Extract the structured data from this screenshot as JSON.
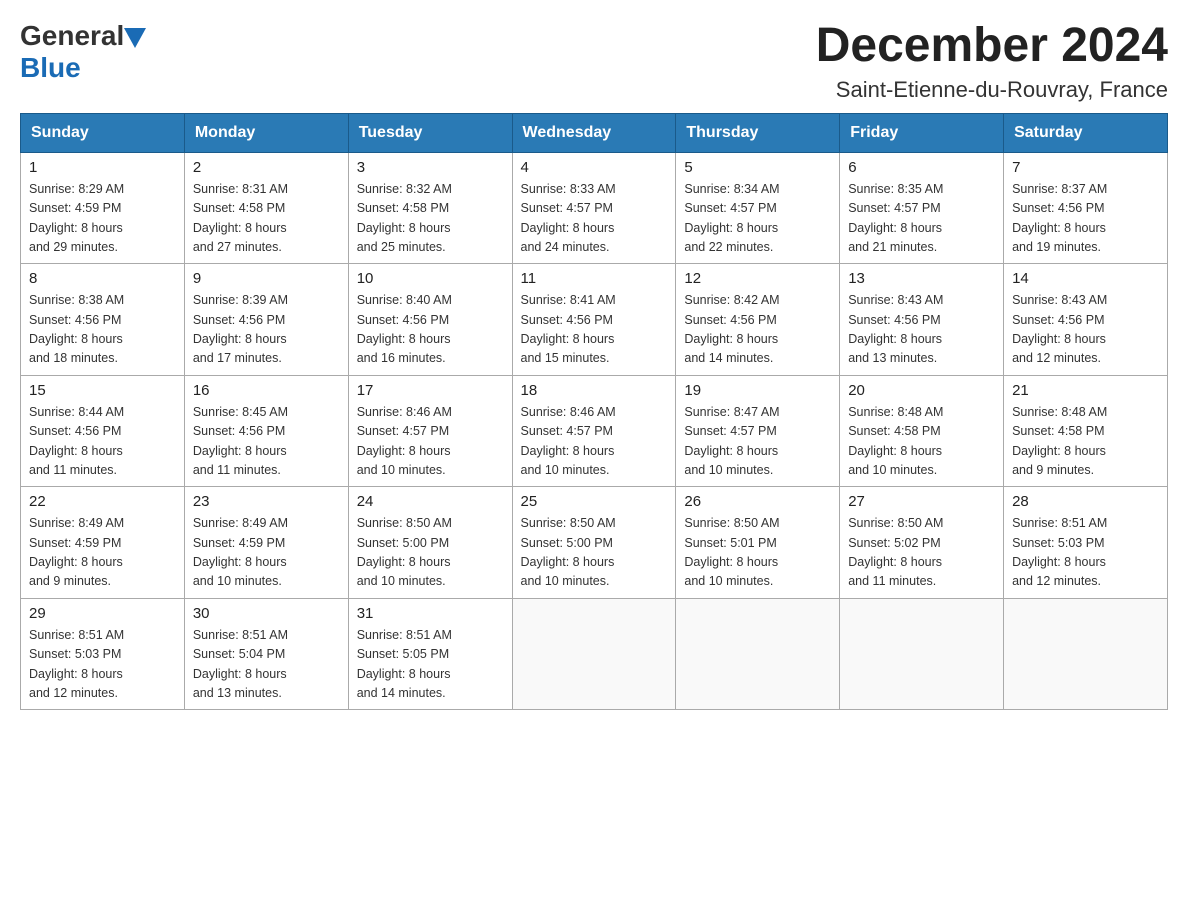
{
  "header": {
    "logo_general": "General",
    "logo_blue": "Blue",
    "month_title": "December 2024",
    "location": "Saint-Etienne-du-Rouvray, France"
  },
  "days_of_week": [
    "Sunday",
    "Monday",
    "Tuesday",
    "Wednesday",
    "Thursday",
    "Friday",
    "Saturday"
  ],
  "weeks": [
    [
      {
        "day": "1",
        "info": "Sunrise: 8:29 AM\nSunset: 4:59 PM\nDaylight: 8 hours\nand 29 minutes."
      },
      {
        "day": "2",
        "info": "Sunrise: 8:31 AM\nSunset: 4:58 PM\nDaylight: 8 hours\nand 27 minutes."
      },
      {
        "day": "3",
        "info": "Sunrise: 8:32 AM\nSunset: 4:58 PM\nDaylight: 8 hours\nand 25 minutes."
      },
      {
        "day": "4",
        "info": "Sunrise: 8:33 AM\nSunset: 4:57 PM\nDaylight: 8 hours\nand 24 minutes."
      },
      {
        "day": "5",
        "info": "Sunrise: 8:34 AM\nSunset: 4:57 PM\nDaylight: 8 hours\nand 22 minutes."
      },
      {
        "day": "6",
        "info": "Sunrise: 8:35 AM\nSunset: 4:57 PM\nDaylight: 8 hours\nand 21 minutes."
      },
      {
        "day": "7",
        "info": "Sunrise: 8:37 AM\nSunset: 4:56 PM\nDaylight: 8 hours\nand 19 minutes."
      }
    ],
    [
      {
        "day": "8",
        "info": "Sunrise: 8:38 AM\nSunset: 4:56 PM\nDaylight: 8 hours\nand 18 minutes."
      },
      {
        "day": "9",
        "info": "Sunrise: 8:39 AM\nSunset: 4:56 PM\nDaylight: 8 hours\nand 17 minutes."
      },
      {
        "day": "10",
        "info": "Sunrise: 8:40 AM\nSunset: 4:56 PM\nDaylight: 8 hours\nand 16 minutes."
      },
      {
        "day": "11",
        "info": "Sunrise: 8:41 AM\nSunset: 4:56 PM\nDaylight: 8 hours\nand 15 minutes."
      },
      {
        "day": "12",
        "info": "Sunrise: 8:42 AM\nSunset: 4:56 PM\nDaylight: 8 hours\nand 14 minutes."
      },
      {
        "day": "13",
        "info": "Sunrise: 8:43 AM\nSunset: 4:56 PM\nDaylight: 8 hours\nand 13 minutes."
      },
      {
        "day": "14",
        "info": "Sunrise: 8:43 AM\nSunset: 4:56 PM\nDaylight: 8 hours\nand 12 minutes."
      }
    ],
    [
      {
        "day": "15",
        "info": "Sunrise: 8:44 AM\nSunset: 4:56 PM\nDaylight: 8 hours\nand 11 minutes."
      },
      {
        "day": "16",
        "info": "Sunrise: 8:45 AM\nSunset: 4:56 PM\nDaylight: 8 hours\nand 11 minutes."
      },
      {
        "day": "17",
        "info": "Sunrise: 8:46 AM\nSunset: 4:57 PM\nDaylight: 8 hours\nand 10 minutes."
      },
      {
        "day": "18",
        "info": "Sunrise: 8:46 AM\nSunset: 4:57 PM\nDaylight: 8 hours\nand 10 minutes."
      },
      {
        "day": "19",
        "info": "Sunrise: 8:47 AM\nSunset: 4:57 PM\nDaylight: 8 hours\nand 10 minutes."
      },
      {
        "day": "20",
        "info": "Sunrise: 8:48 AM\nSunset: 4:58 PM\nDaylight: 8 hours\nand 10 minutes."
      },
      {
        "day": "21",
        "info": "Sunrise: 8:48 AM\nSunset: 4:58 PM\nDaylight: 8 hours\nand 9 minutes."
      }
    ],
    [
      {
        "day": "22",
        "info": "Sunrise: 8:49 AM\nSunset: 4:59 PM\nDaylight: 8 hours\nand 9 minutes."
      },
      {
        "day": "23",
        "info": "Sunrise: 8:49 AM\nSunset: 4:59 PM\nDaylight: 8 hours\nand 10 minutes."
      },
      {
        "day": "24",
        "info": "Sunrise: 8:50 AM\nSunset: 5:00 PM\nDaylight: 8 hours\nand 10 minutes."
      },
      {
        "day": "25",
        "info": "Sunrise: 8:50 AM\nSunset: 5:00 PM\nDaylight: 8 hours\nand 10 minutes."
      },
      {
        "day": "26",
        "info": "Sunrise: 8:50 AM\nSunset: 5:01 PM\nDaylight: 8 hours\nand 10 minutes."
      },
      {
        "day": "27",
        "info": "Sunrise: 8:50 AM\nSunset: 5:02 PM\nDaylight: 8 hours\nand 11 minutes."
      },
      {
        "day": "28",
        "info": "Sunrise: 8:51 AM\nSunset: 5:03 PM\nDaylight: 8 hours\nand 12 minutes."
      }
    ],
    [
      {
        "day": "29",
        "info": "Sunrise: 8:51 AM\nSunset: 5:03 PM\nDaylight: 8 hours\nand 12 minutes."
      },
      {
        "day": "30",
        "info": "Sunrise: 8:51 AM\nSunset: 5:04 PM\nDaylight: 8 hours\nand 13 minutes."
      },
      {
        "day": "31",
        "info": "Sunrise: 8:51 AM\nSunset: 5:05 PM\nDaylight: 8 hours\nand 14 minutes."
      },
      null,
      null,
      null,
      null
    ]
  ]
}
